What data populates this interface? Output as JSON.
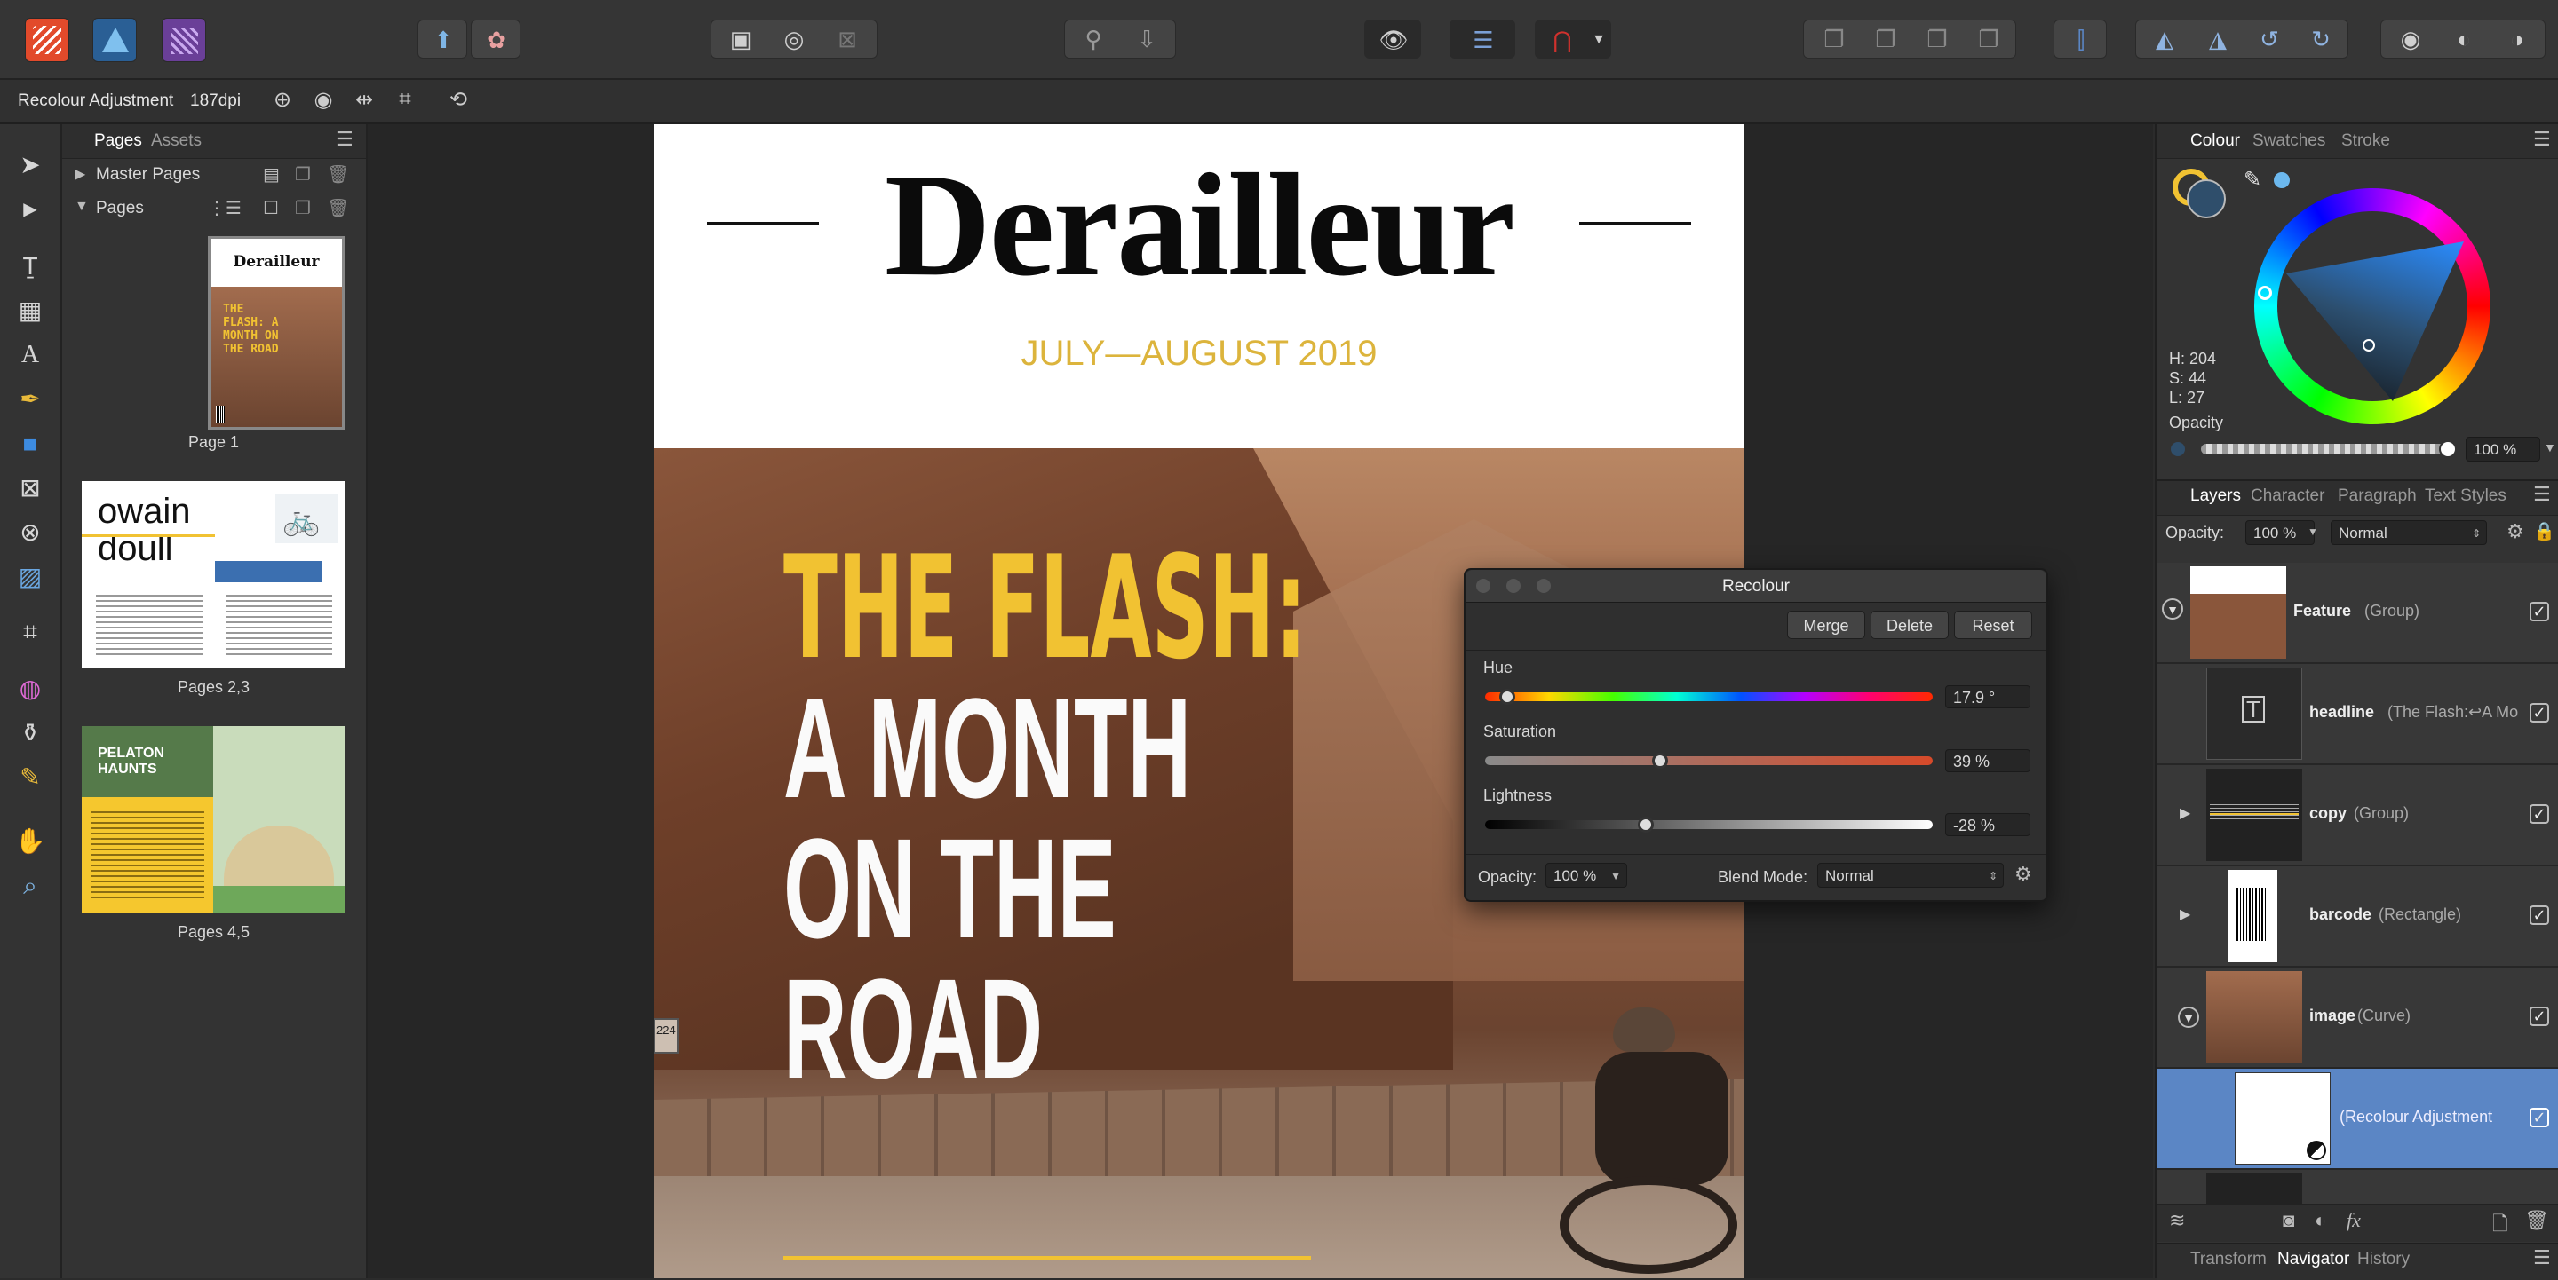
{
  "app": {
    "context": {
      "title": "Recolour Adjustment",
      "dpi": "187dpi"
    }
  },
  "pages_panel": {
    "tabs": [
      "Pages",
      "Assets"
    ],
    "sections": [
      "Master Pages",
      "Pages"
    ],
    "page_labels": [
      "Page 1",
      "Pages 2,3",
      "Pages 4,5"
    ],
    "thumb1": {
      "title": "Derailleur",
      "headline": "THE FLASH: A MONTH ON THE ROAD"
    },
    "thumb2": {
      "line1": "owain",
      "line2": "doull"
    },
    "thumb3": {
      "line1": "PELATON",
      "line2": "HAUNTS"
    }
  },
  "document": {
    "masthead": "Derailleur",
    "issue": "JULY—AUGUST 2019",
    "headline_1": "THE FLASH:",
    "headline_2": "A MONTH",
    "headline_3": "ON THE",
    "headline_4": "ROAD",
    "sign": "224"
  },
  "colour_panel": {
    "tabs": [
      "Colour",
      "Swatches",
      "Stroke"
    ],
    "h": "H: 204",
    "s": "S: 44",
    "l": "L: 27",
    "opacity_label": "Opacity",
    "opacity_value": "100 %",
    "selected_color": "#2f4e6b"
  },
  "layers_panel": {
    "tabs": [
      "Layers",
      "Character",
      "Paragraph",
      "Text Styles"
    ],
    "opacity_label": "Opacity:",
    "opacity_value": "100 %",
    "blend_mode": "Normal",
    "layers": [
      {
        "name": "Feature",
        "type": "(Group)"
      },
      {
        "name": "headline",
        "type": "(The Flash:↩A Mo"
      },
      {
        "name": "copy",
        "type": "(Group)"
      },
      {
        "name": "barcode",
        "type": "(Rectangle)"
      },
      {
        "name": "image",
        "type": "(Curve)"
      },
      {
        "name": "",
        "type": "(Recolour Adjustment"
      }
    ],
    "bottom_tabs": [
      "Transform",
      "Navigator",
      "History"
    ]
  },
  "recolour_dialog": {
    "title": "Recolour",
    "buttons": [
      "Merge",
      "Delete",
      "Reset"
    ],
    "hue_label": "Hue",
    "hue_value": "17.9 °",
    "hue": 0.05,
    "saturation_label": "Saturation",
    "saturation_value": "39 %",
    "saturation": 0.39,
    "lightness_label": "Lightness",
    "lightness_value": "-28 %",
    "lightness": 0.36,
    "opacity_label": "Opacity:",
    "opacity_value": "100 %",
    "blend_label": "Blend Mode:",
    "blend_value": "Normal"
  },
  "colors": {
    "accent_yellow": "#f1c232",
    "selection_blue": "#5b86c5",
    "tag_red": "#d0312d"
  }
}
